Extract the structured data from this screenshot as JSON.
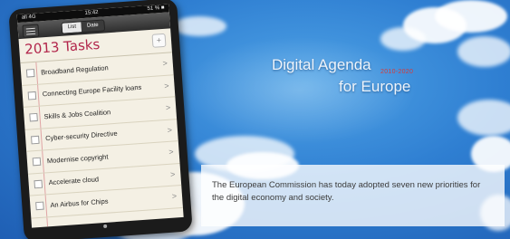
{
  "banner": {
    "headline_line1": "Digital Agenda",
    "headline_line2": "for Europe",
    "years": "2010-2020",
    "caption": "The European Commission has today adopted seven new priorities for the digital economy and society."
  },
  "phone": {
    "status": {
      "carrier": "all 4G",
      "time": "15:42",
      "battery": "51 % ■"
    },
    "segments": [
      "List",
      "Date"
    ],
    "active_segment": "List",
    "title": "2013 Tasks",
    "add_symbol": "+",
    "tasks": [
      "Broadband Regulation",
      "Connecting Europe Facility loans",
      "Skills & Jobs Coalition",
      "Cyber-security Directive",
      "Modernise copyright",
      "Accelerate cloud",
      "An Airbus for Chips"
    ],
    "chevron": ">"
  }
}
